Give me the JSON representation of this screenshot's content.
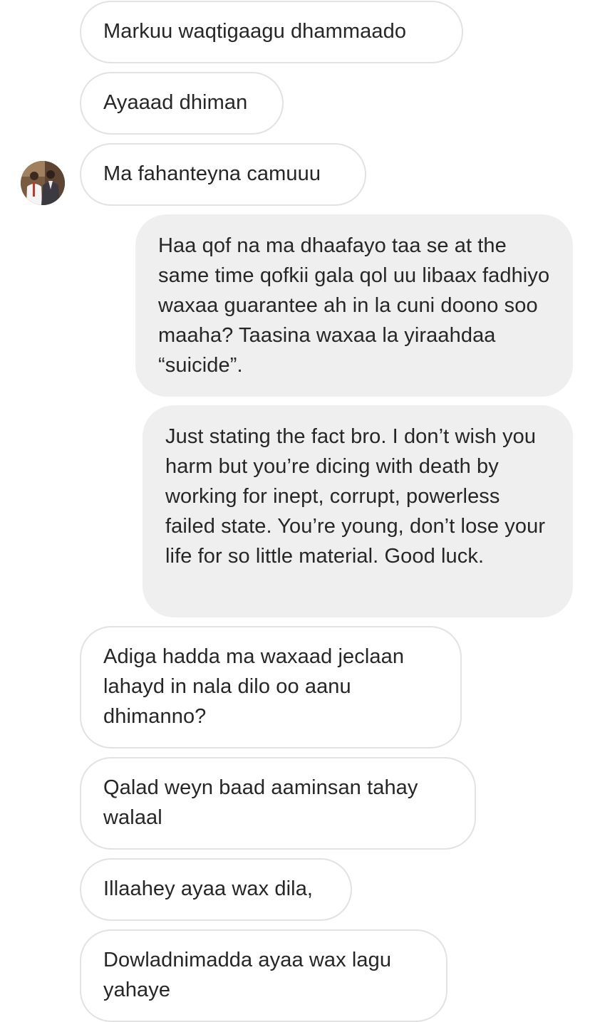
{
  "conversation": {
    "messages": [
      {
        "direction": "received",
        "text": "Markuu waqtigaagu dhammaado"
      },
      {
        "direction": "received",
        "text": "Ayaaad dhiman"
      },
      {
        "direction": "received",
        "text": "Ma fahanteyna camuuu"
      },
      {
        "direction": "sent",
        "text": "Haa qof na ma dhaafayo taa se at the same time qofkii gala qol uu libaax fadhiyo waxaa guarantee ah in la cuni doono soo maaha? Taasina waxaa la yiraahdaa “suicide”."
      },
      {
        "direction": "sent",
        "text": "Just stating the fact bro. I don’t wish you harm but you’re dicing with death by working for inept, corrupt, powerless failed state. You’re young, don’t lose your life for so little material. Good luck."
      },
      {
        "direction": "received",
        "text": "Adiga hadda ma waxaad jeclaan lahayd in nala dilo oo aanu dhimanno?"
      },
      {
        "direction": "received",
        "text": "Qalad weyn baad aaminsan tahay walaal"
      },
      {
        "direction": "received",
        "text": "Illaahey ayaa wax dila,"
      },
      {
        "direction": "received",
        "text": "Dowladnimadda ayaa wax lagu yahaye"
      }
    ]
  },
  "colors": {
    "sent_bubble_bg": "#efefef",
    "received_bubble_border": "#e2e2e2",
    "text": "#262626"
  },
  "icons": {
    "avatar": "contact-avatar-photo"
  }
}
